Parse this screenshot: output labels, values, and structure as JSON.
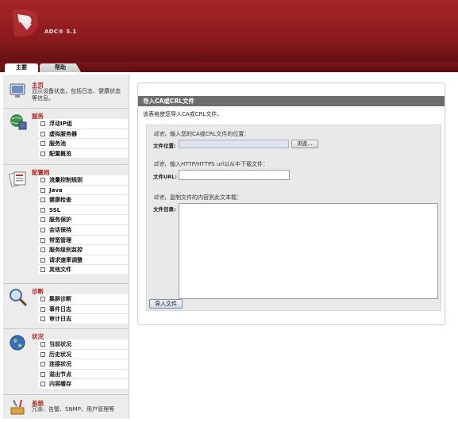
{
  "app": {
    "title": "ADC® 5.1"
  },
  "tabs": [
    {
      "label": "主要",
      "active": true
    },
    {
      "label": "帮助",
      "active": false
    }
  ],
  "sidebar": {
    "home": {
      "title": "主页",
      "desc": "显示设备状态，包括日志、健康状态等信息。",
      "icon": "monitor-icon"
    },
    "services": {
      "title": "服务",
      "icon": "globe-server-icon",
      "items": [
        "浮动IP组",
        "虚拟服务器",
        "服务池",
        "配置概览"
      ]
    },
    "profiles": {
      "title": "配置档",
      "icon": "profile-cards-icon",
      "items": [
        "流量控制规则",
        "Java",
        "健康检查",
        "SSL",
        "服务保护",
        "会话保持",
        "带宽管理",
        "服务级别监控",
        "请求速率调整",
        "其他文件"
      ]
    },
    "diagnostics": {
      "title": "诊断",
      "icon": "magnifier-icon",
      "items": [
        "集群诊断",
        "事件日志",
        "审计日志"
      ]
    },
    "status": {
      "title": "状况",
      "icon": "globe-icon",
      "items": [
        "当前状况",
        "历史状况",
        "连接状况",
        "溢出节点",
        "内容缓存"
      ]
    },
    "system": {
      "title": "系统",
      "desc": "冗余、告警、SNMP、用户管理等",
      "icon": "tools-icon"
    }
  },
  "main": {
    "section_title": "导入CA或CRL文件",
    "intro": "该表格使您导入CA或CRL文件。",
    "step1": {
      "prefix": "或者",
      "text": "，输入您的CA或CRL文件的位置：",
      "field_label": "文件位置:",
      "file_value": "",
      "browse_label": "浏览..."
    },
    "step2": {
      "prefix": "或者",
      "text": "，输入HTTP/HTTPS url以从中下载文件：",
      "field_label": "文件URL:",
      "url_value": ""
    },
    "step3": {
      "prefix": "或者",
      "text": "，复制文件的内容到此文本框：",
      "field_label": "文件目录:",
      "content_value": ""
    },
    "import_label": "导入文件"
  }
}
